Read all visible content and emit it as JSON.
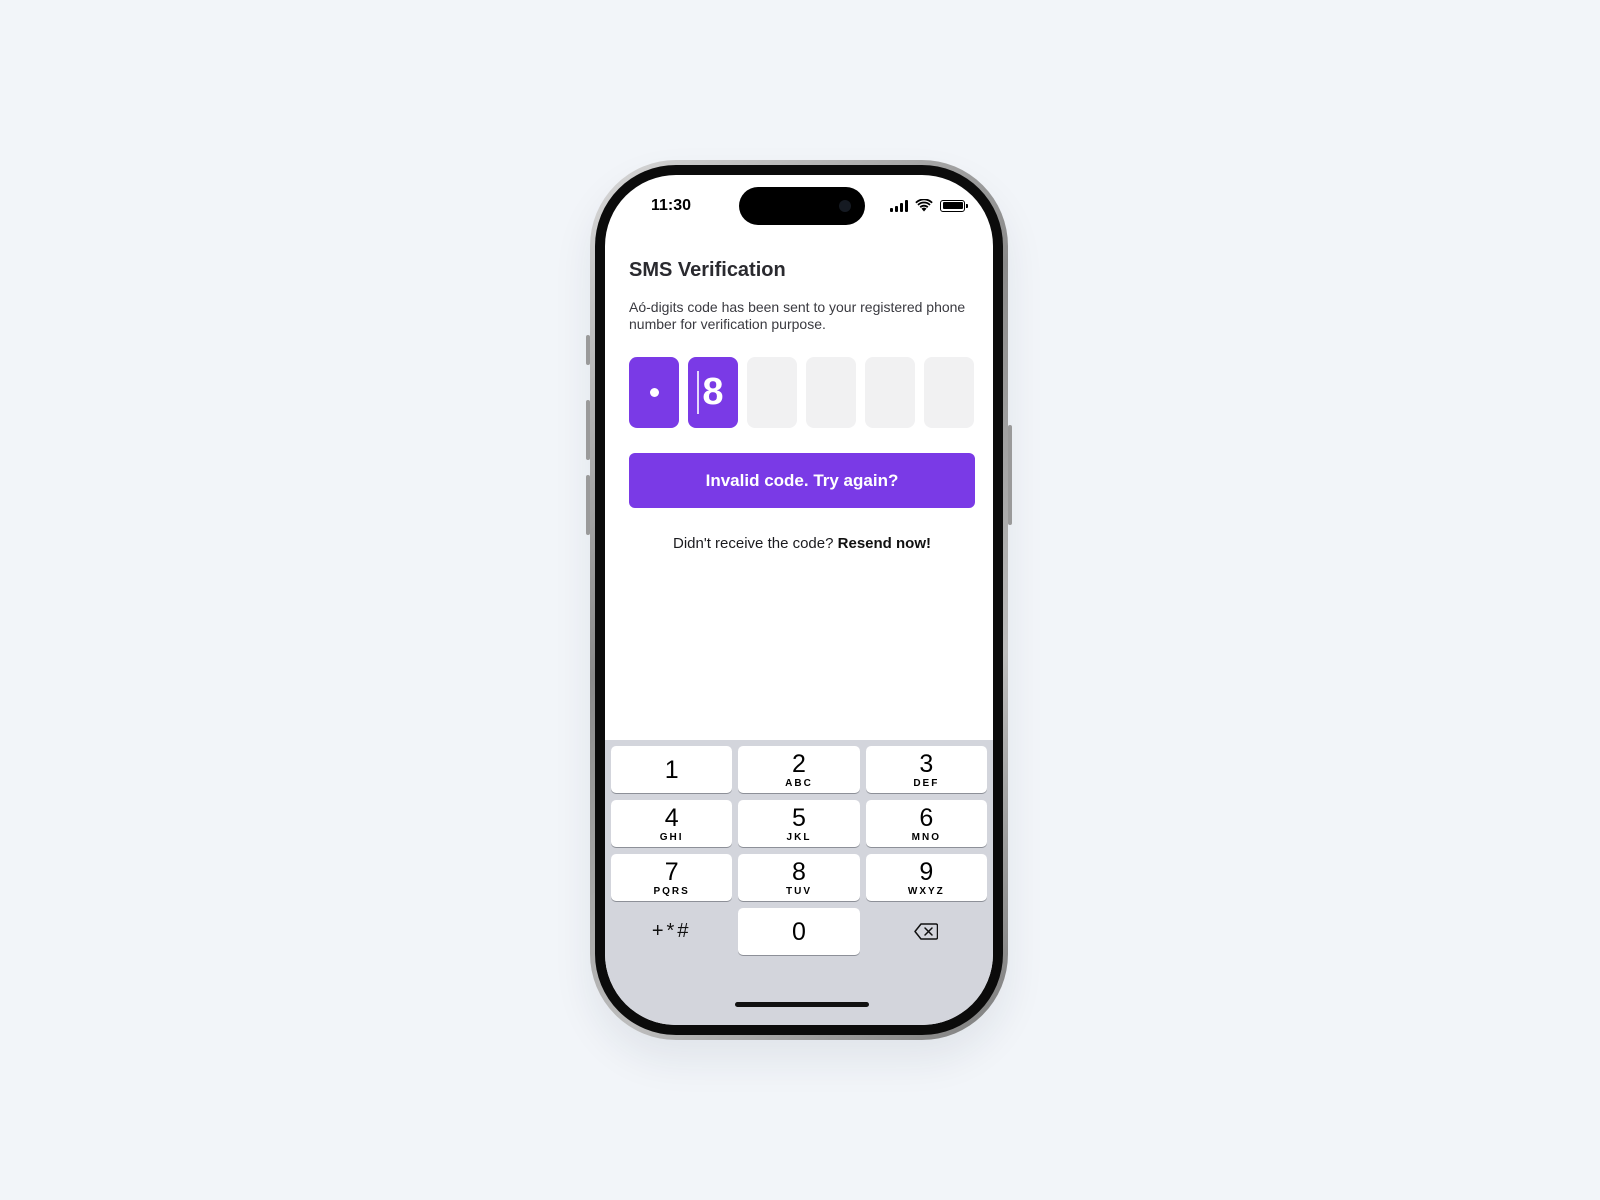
{
  "status_bar": {
    "time": "11:30"
  },
  "screen": {
    "title": "SMS Verification",
    "description": "Aó-digits code has been sent to your registered phone number for verification purpose.",
    "otp": {
      "digit_2": "8"
    },
    "primary_button": "Invalid code. Try again?",
    "resend_prefix": "Didn't receive the code?",
    "resend_link": "Resend now!"
  },
  "keypad": {
    "keys": [
      {
        "num": "1",
        "letters": ""
      },
      {
        "num": "2",
        "letters": "ABC"
      },
      {
        "num": "3",
        "letters": "DEF"
      },
      {
        "num": "4",
        "letters": "GHI"
      },
      {
        "num": "5",
        "letters": "JKL"
      },
      {
        "num": "6",
        "letters": "MNO"
      },
      {
        "num": "7",
        "letters": "PQRS"
      },
      {
        "num": "8",
        "letters": "TUV"
      },
      {
        "num": "9",
        "letters": "WXYZ"
      },
      {
        "num": "0",
        "letters": ""
      }
    ],
    "symbols": "+*#",
    "delete_icon": "backspace-icon"
  },
  "colors": {
    "accent": "#7a3ae6",
    "keypad_bg": "#d3d5dc",
    "page_bg": "#f2f5f9"
  }
}
